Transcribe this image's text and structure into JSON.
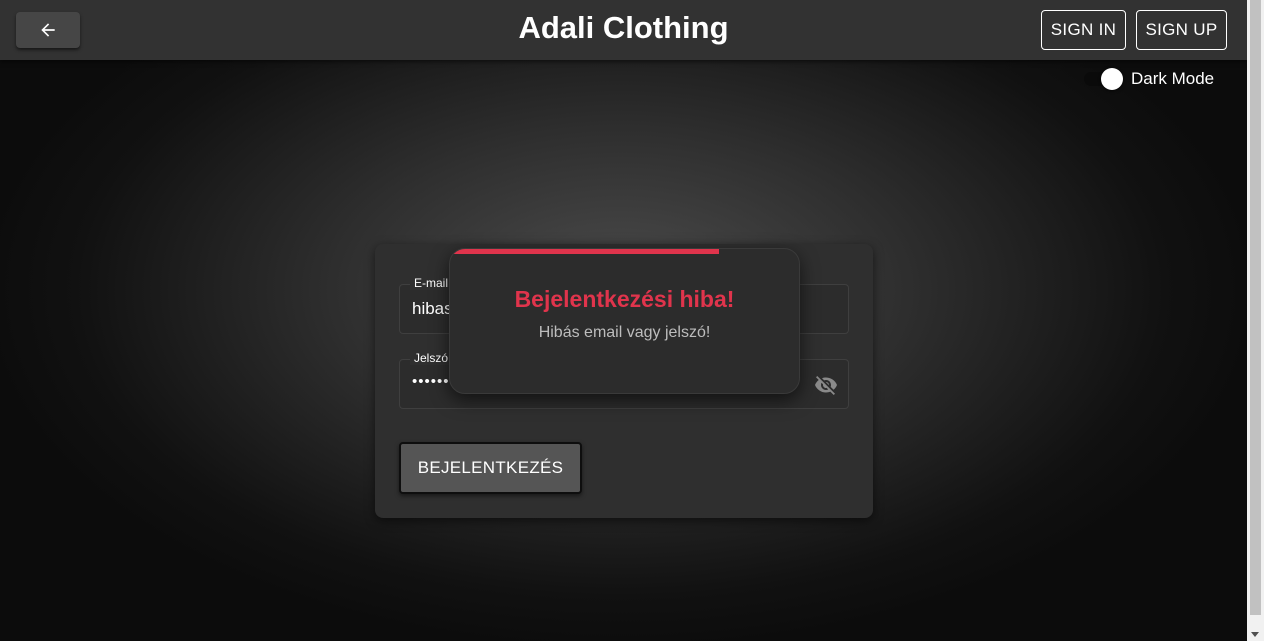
{
  "header": {
    "title": "Adali Clothing",
    "back_icon": "arrow-left-icon",
    "signin_label": "SIGN IN",
    "signup_label": "SIGN UP"
  },
  "theme_toggle": {
    "label": "Dark Mode",
    "checked": true
  },
  "login_form": {
    "email_label": "E-mail",
    "email_value": "hibas",
    "password_label": "Jelszó",
    "password_value": "•••••••",
    "visibility_icon": "eye-off-icon",
    "submit_label": "BEJELENTKEZÉS"
  },
  "toast": {
    "title": "Bejelentkezési hiba!",
    "message": "Hibás email vagy jelszó!",
    "progress_fraction": 0.77,
    "accent_color": "#e0344c"
  },
  "colors": {
    "appbar": "#323232",
    "card": "#2f2f2f",
    "button": "#555555",
    "error": "#e0344c"
  }
}
